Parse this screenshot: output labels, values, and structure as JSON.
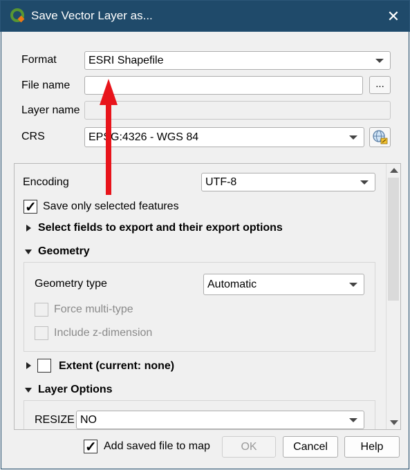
{
  "window": {
    "title": "Save Vector Layer as...",
    "close_glyph": "✕"
  },
  "form": {
    "format_label": "Format",
    "format_value": "ESRI Shapefile",
    "file_name_label": "File name",
    "file_name_value": "",
    "browse_label": "...",
    "layer_name_label": "Layer name",
    "layer_name_value": "",
    "crs_label": "CRS",
    "crs_value": "EPSG:4326 - WGS 84"
  },
  "options": {
    "encoding_label": "Encoding",
    "encoding_value": "UTF-8",
    "save_selected_label": "Save only selected features",
    "save_selected_checked": true,
    "select_fields_label": "Select fields to export and their export options",
    "geometry_section_label": "Geometry",
    "geometry_type_label": "Geometry type",
    "geometry_type_value": "Automatic",
    "force_multi_label": "Force multi-type",
    "include_z_label": "Include z-dimension",
    "extent_label": "Extent (current: none)",
    "layer_options_label": "Layer Options",
    "resize_label": "RESIZE",
    "resize_value": "NO"
  },
  "footer": {
    "add_to_map_label": "Add saved file to map",
    "add_to_map_checked": true,
    "ok_label": "OK",
    "cancel_label": "Cancel",
    "help_label": "Help"
  },
  "colors": {
    "titlebar": "#1f4a6a",
    "annotation_arrow": "#e8141b",
    "qgis_green": "#589632"
  },
  "icons": {
    "app": "qgis-logo-icon",
    "crs": "globe-projection-icon",
    "annotation": "red-arrow-annotation"
  }
}
